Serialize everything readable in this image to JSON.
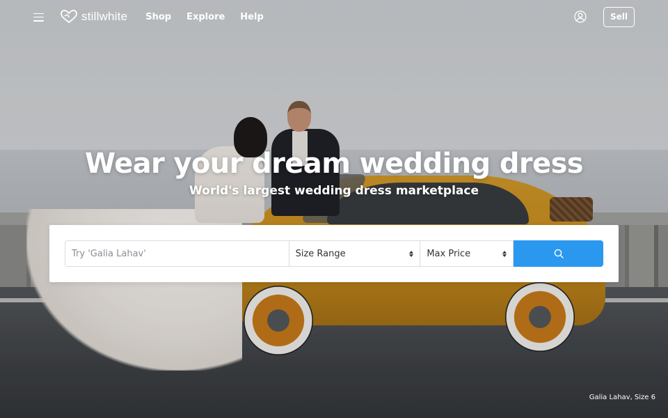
{
  "header": {
    "logo_text": "stillwhite",
    "nav": [
      {
        "label": "Shop"
      },
      {
        "label": "Explore"
      },
      {
        "label": "Help"
      }
    ],
    "sell_label": "Sell",
    "icons": {
      "menu": "hamburger-menu-icon",
      "logo": "heart-logo-icon",
      "account": "user-account-icon"
    }
  },
  "hero": {
    "title": "Wear your dream wedding dress",
    "subtitle": "World's largest wedding dress marketplace",
    "photo_caption": "Galia Lahav, Size 6"
  },
  "search": {
    "placeholder": "Try 'Galia Lahav'",
    "value": "",
    "size_select": "Size Range",
    "price_select": "Max Price",
    "button_icon": "search-icon"
  },
  "colors": {
    "accent": "#2b98f0",
    "panel": "#ffffff",
    "text_on_hero": "#ffffff"
  }
}
